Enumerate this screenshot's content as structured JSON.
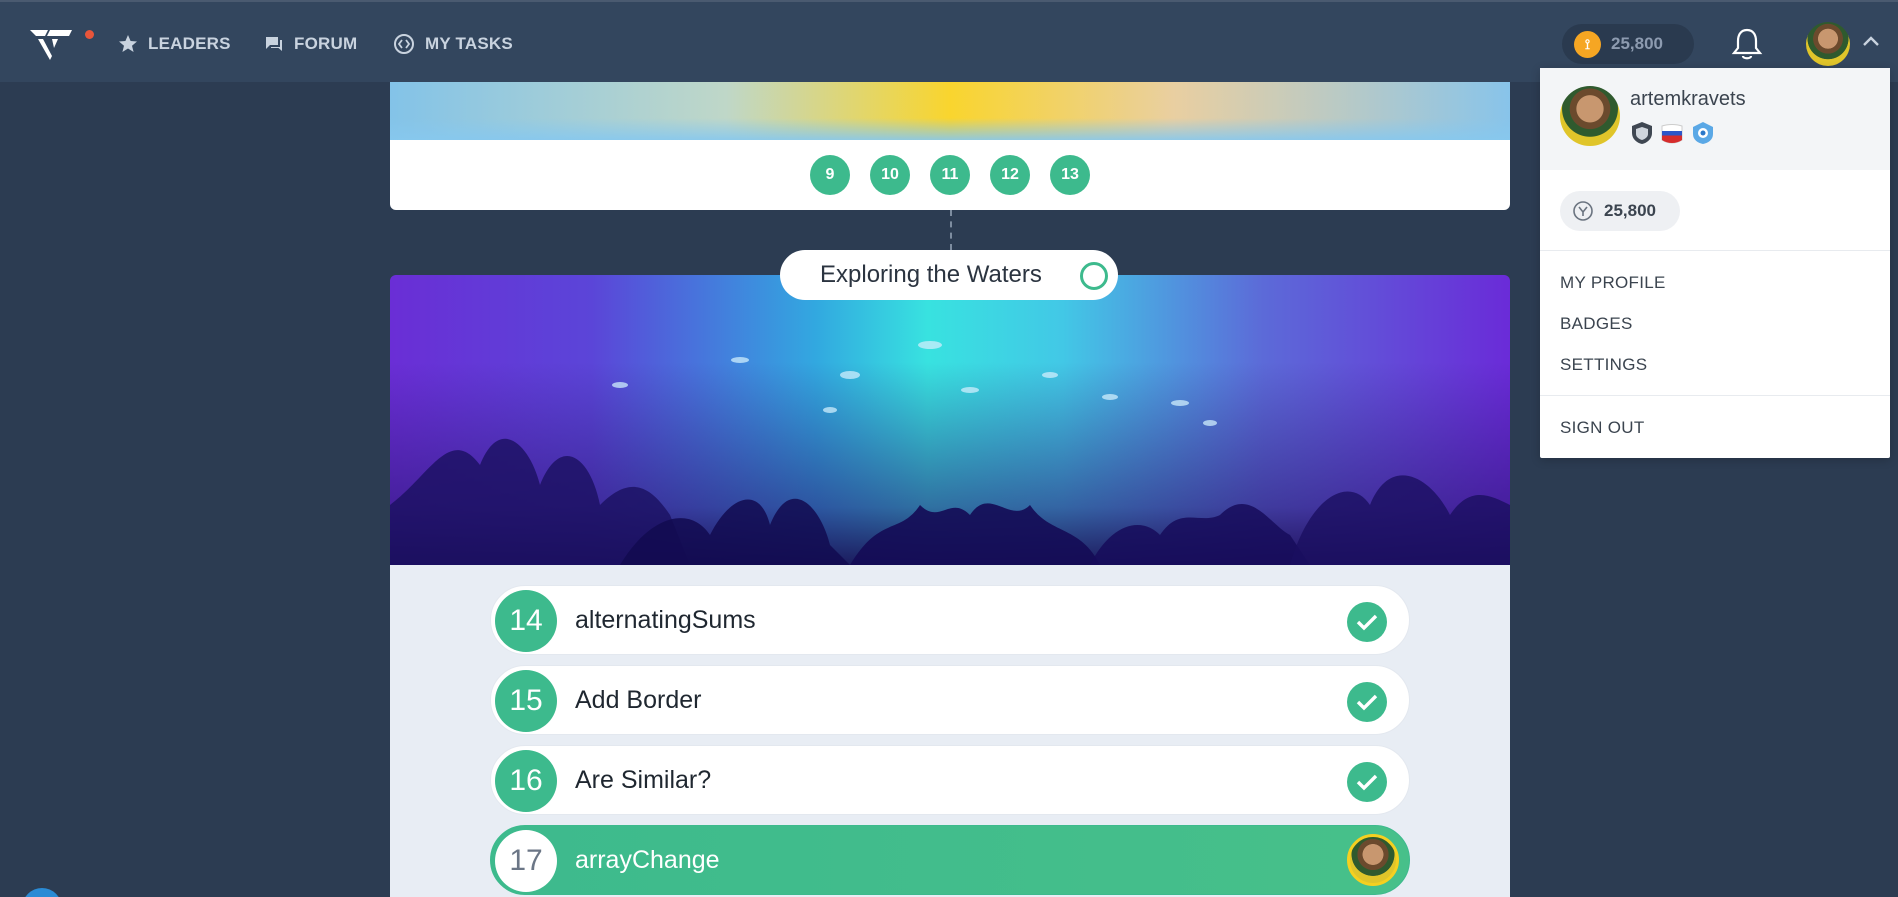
{
  "nav": {
    "items": [
      {
        "label": "LEADERS",
        "icon": "star-icon"
      },
      {
        "label": "FORUM",
        "icon": "forum-icon"
      },
      {
        "label": "MY TASKS",
        "icon": "code-icon"
      }
    ],
    "coins": "25,800"
  },
  "levels": [
    "9",
    "10",
    "11",
    "12",
    "13"
  ],
  "section": {
    "title": "Exploring the Waters"
  },
  "tasks": [
    {
      "num": "14",
      "name": "alternatingSums",
      "status": "completed"
    },
    {
      "num": "15",
      "name": "Add Border",
      "status": "completed"
    },
    {
      "num": "16",
      "name": "Are Similar?",
      "status": "completed"
    },
    {
      "num": "17",
      "name": "arrayChange",
      "status": "current"
    }
  ],
  "dropdown": {
    "username": "artemkravets",
    "coins": "25,800",
    "links": [
      "MY PROFILE",
      "BADGES",
      "SETTINGS"
    ],
    "signout": "SIGN OUT"
  },
  "colors": {
    "accent": "#3dba8d",
    "topbar": "#33465e",
    "background": "#2c3c52",
    "coin": "#f6a623"
  }
}
